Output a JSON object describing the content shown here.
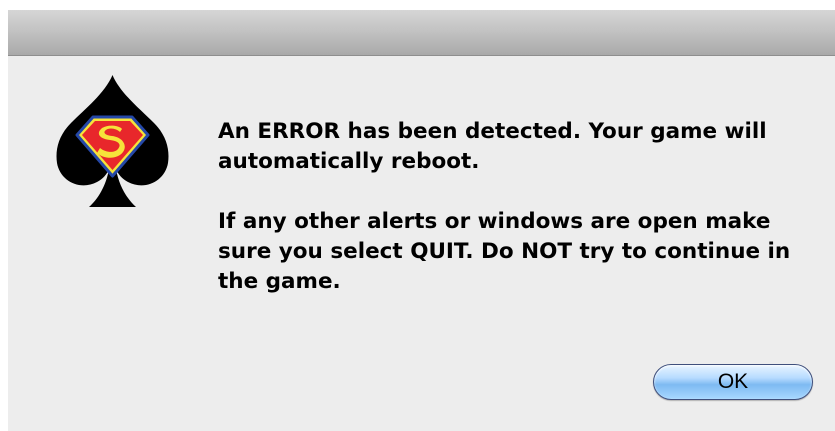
{
  "dialog": {
    "message_line_1": "An ERROR has been detected. Your game will automatically reboot.",
    "message_line_2": "If any other alerts or windows are open make sure you select QUIT. Do NOT try to continue in the game.",
    "ok_label": "OK",
    "icon": "spade-superman-logo-icon",
    "logo_letter": "S"
  },
  "colors": {
    "dialog_background": "#ededed",
    "spade": "#000000",
    "shield_red": "#e8272b",
    "shield_yellow": "#f6e33a",
    "shield_outline": "#2548a8",
    "button_blue": "#a8d8ff"
  }
}
